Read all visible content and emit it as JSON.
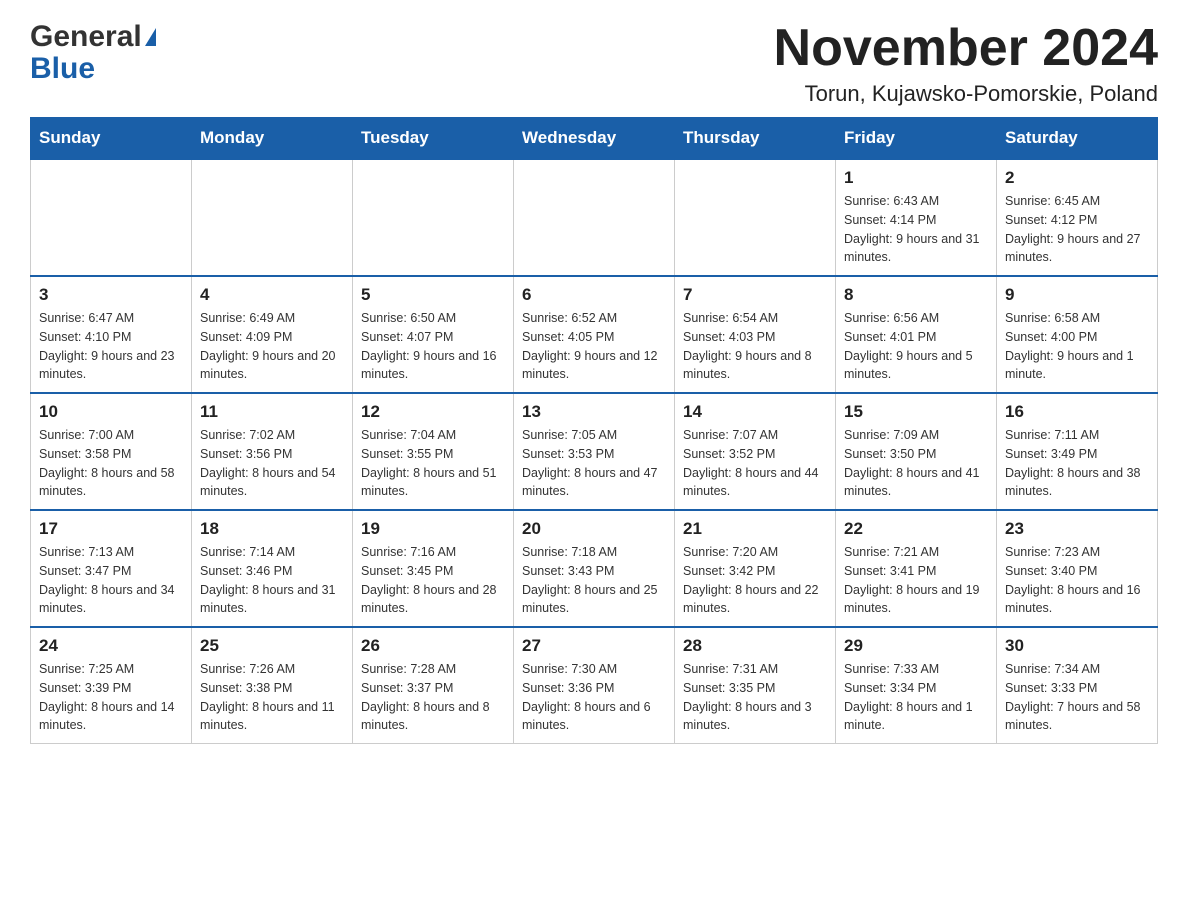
{
  "header": {
    "logo_general": "General",
    "logo_blue": "Blue",
    "month_title": "November 2024",
    "location": "Torun, Kujawsko-Pomorskie, Poland"
  },
  "days_of_week": [
    "Sunday",
    "Monday",
    "Tuesday",
    "Wednesday",
    "Thursday",
    "Friday",
    "Saturday"
  ],
  "weeks": [
    {
      "days": [
        {
          "number": "",
          "info": "",
          "empty": true
        },
        {
          "number": "",
          "info": "",
          "empty": true
        },
        {
          "number": "",
          "info": "",
          "empty": true
        },
        {
          "number": "",
          "info": "",
          "empty": true
        },
        {
          "number": "",
          "info": "",
          "empty": true
        },
        {
          "number": "1",
          "info": "Sunrise: 6:43 AM\nSunset: 4:14 PM\nDaylight: 9 hours and 31 minutes."
        },
        {
          "number": "2",
          "info": "Sunrise: 6:45 AM\nSunset: 4:12 PM\nDaylight: 9 hours and 27 minutes."
        }
      ]
    },
    {
      "days": [
        {
          "number": "3",
          "info": "Sunrise: 6:47 AM\nSunset: 4:10 PM\nDaylight: 9 hours and 23 minutes."
        },
        {
          "number": "4",
          "info": "Sunrise: 6:49 AM\nSunset: 4:09 PM\nDaylight: 9 hours and 20 minutes."
        },
        {
          "number": "5",
          "info": "Sunrise: 6:50 AM\nSunset: 4:07 PM\nDaylight: 9 hours and 16 minutes."
        },
        {
          "number": "6",
          "info": "Sunrise: 6:52 AM\nSunset: 4:05 PM\nDaylight: 9 hours and 12 minutes."
        },
        {
          "number": "7",
          "info": "Sunrise: 6:54 AM\nSunset: 4:03 PM\nDaylight: 9 hours and 8 minutes."
        },
        {
          "number": "8",
          "info": "Sunrise: 6:56 AM\nSunset: 4:01 PM\nDaylight: 9 hours and 5 minutes."
        },
        {
          "number": "9",
          "info": "Sunrise: 6:58 AM\nSunset: 4:00 PM\nDaylight: 9 hours and 1 minute."
        }
      ]
    },
    {
      "days": [
        {
          "number": "10",
          "info": "Sunrise: 7:00 AM\nSunset: 3:58 PM\nDaylight: 8 hours and 58 minutes."
        },
        {
          "number": "11",
          "info": "Sunrise: 7:02 AM\nSunset: 3:56 PM\nDaylight: 8 hours and 54 minutes."
        },
        {
          "number": "12",
          "info": "Sunrise: 7:04 AM\nSunset: 3:55 PM\nDaylight: 8 hours and 51 minutes."
        },
        {
          "number": "13",
          "info": "Sunrise: 7:05 AM\nSunset: 3:53 PM\nDaylight: 8 hours and 47 minutes."
        },
        {
          "number": "14",
          "info": "Sunrise: 7:07 AM\nSunset: 3:52 PM\nDaylight: 8 hours and 44 minutes."
        },
        {
          "number": "15",
          "info": "Sunrise: 7:09 AM\nSunset: 3:50 PM\nDaylight: 8 hours and 41 minutes."
        },
        {
          "number": "16",
          "info": "Sunrise: 7:11 AM\nSunset: 3:49 PM\nDaylight: 8 hours and 38 minutes."
        }
      ]
    },
    {
      "days": [
        {
          "number": "17",
          "info": "Sunrise: 7:13 AM\nSunset: 3:47 PM\nDaylight: 8 hours and 34 minutes."
        },
        {
          "number": "18",
          "info": "Sunrise: 7:14 AM\nSunset: 3:46 PM\nDaylight: 8 hours and 31 minutes."
        },
        {
          "number": "19",
          "info": "Sunrise: 7:16 AM\nSunset: 3:45 PM\nDaylight: 8 hours and 28 minutes."
        },
        {
          "number": "20",
          "info": "Sunrise: 7:18 AM\nSunset: 3:43 PM\nDaylight: 8 hours and 25 minutes."
        },
        {
          "number": "21",
          "info": "Sunrise: 7:20 AM\nSunset: 3:42 PM\nDaylight: 8 hours and 22 minutes."
        },
        {
          "number": "22",
          "info": "Sunrise: 7:21 AM\nSunset: 3:41 PM\nDaylight: 8 hours and 19 minutes."
        },
        {
          "number": "23",
          "info": "Sunrise: 7:23 AM\nSunset: 3:40 PM\nDaylight: 8 hours and 16 minutes."
        }
      ]
    },
    {
      "days": [
        {
          "number": "24",
          "info": "Sunrise: 7:25 AM\nSunset: 3:39 PM\nDaylight: 8 hours and 14 minutes."
        },
        {
          "number": "25",
          "info": "Sunrise: 7:26 AM\nSunset: 3:38 PM\nDaylight: 8 hours and 11 minutes."
        },
        {
          "number": "26",
          "info": "Sunrise: 7:28 AM\nSunset: 3:37 PM\nDaylight: 8 hours and 8 minutes."
        },
        {
          "number": "27",
          "info": "Sunrise: 7:30 AM\nSunset: 3:36 PM\nDaylight: 8 hours and 6 minutes."
        },
        {
          "number": "28",
          "info": "Sunrise: 7:31 AM\nSunset: 3:35 PM\nDaylight: 8 hours and 3 minutes."
        },
        {
          "number": "29",
          "info": "Sunrise: 7:33 AM\nSunset: 3:34 PM\nDaylight: 8 hours and 1 minute."
        },
        {
          "number": "30",
          "info": "Sunrise: 7:34 AM\nSunset: 3:33 PM\nDaylight: 7 hours and 58 minutes."
        }
      ]
    }
  ]
}
